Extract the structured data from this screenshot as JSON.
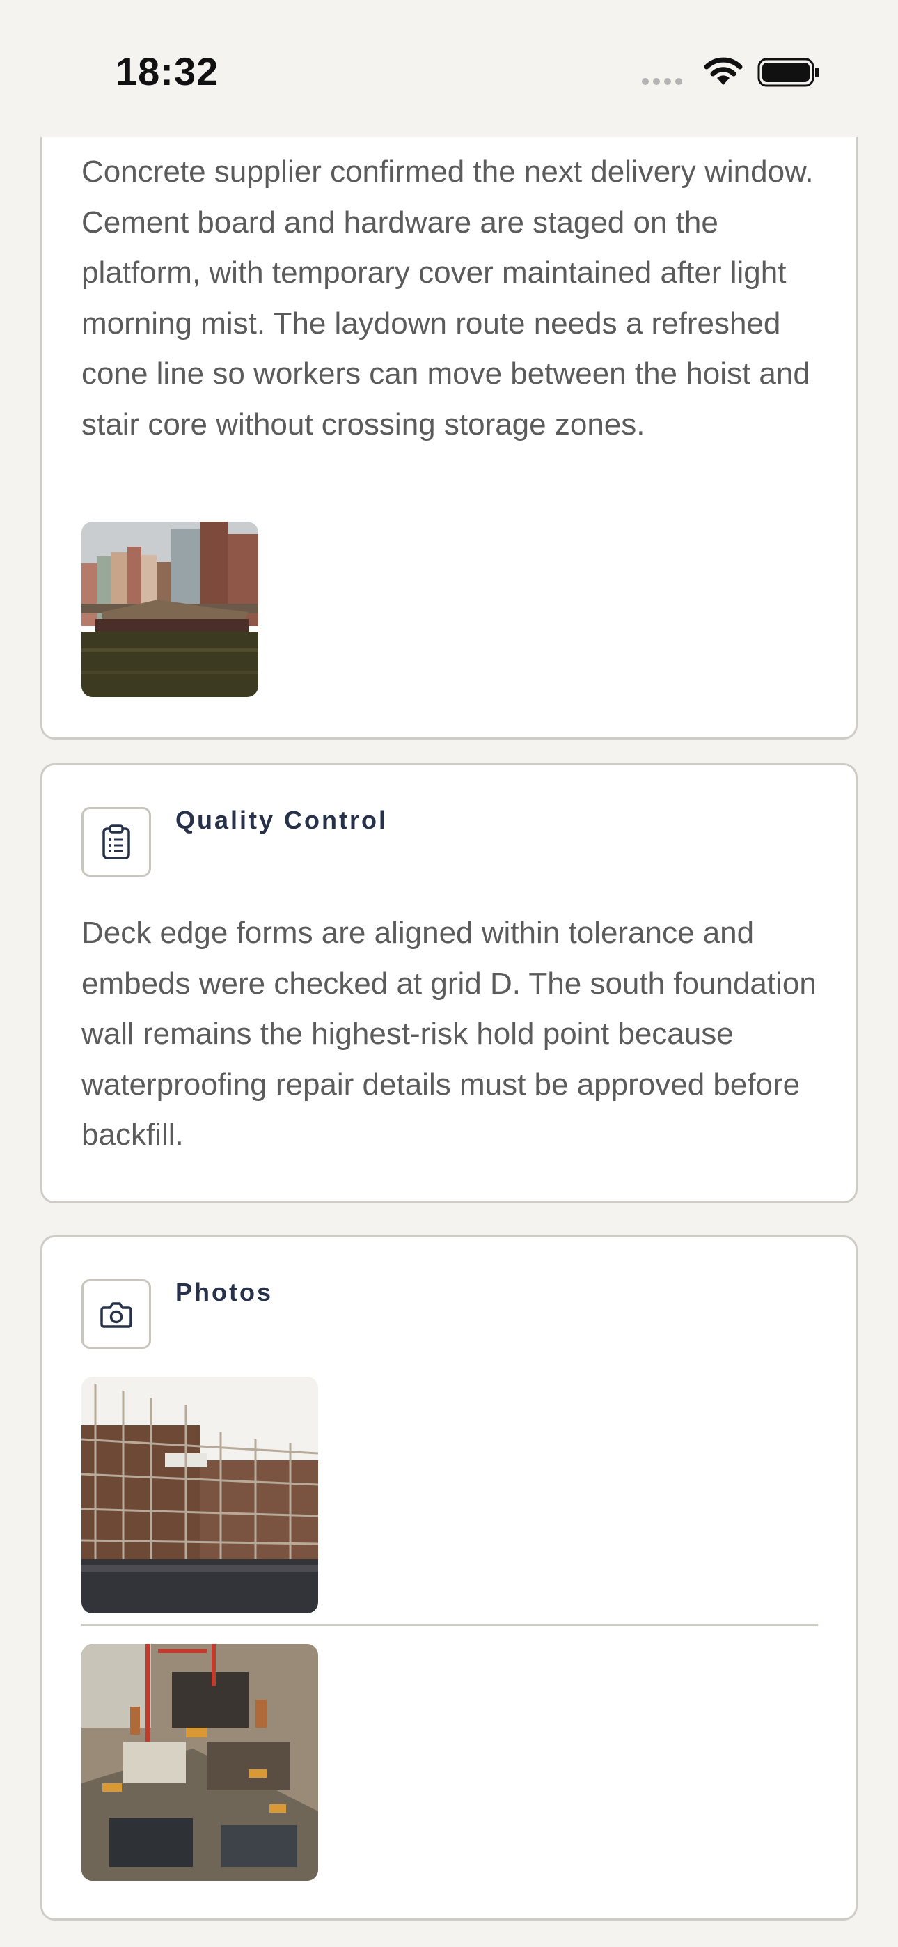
{
  "status_bar": {
    "time": "18:32"
  },
  "cards": [
    {
      "body": "Concrete supplier confirmed the next delivery window. Cement board and hardware are staged on the platform, with temporary cover maintained after light morning mist. The laydown route needs a refreshed cone line so workers can move between the hoist and stair core without crossing storage zones.",
      "photo": "harbor-photo"
    },
    {
      "title": "Quality Control",
      "icon": "clipboard-icon",
      "body": "Deck edge forms are aligned within tolerance and embeds were checked at grid D. The south foundation wall remains the highest-risk hold point because waterproofing repair details must be approved before backfill."
    },
    {
      "title": "Photos",
      "icon": "camera-icon",
      "photos": [
        "scaffold-photo",
        "site-photo"
      ]
    }
  ]
}
